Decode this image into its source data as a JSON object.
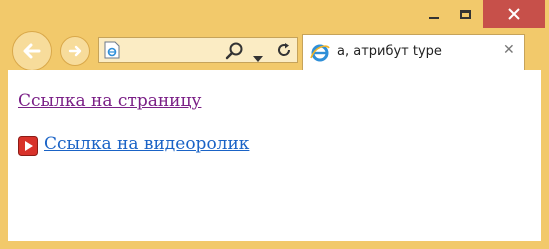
{
  "window": {
    "controls": {
      "minimize": "minimize",
      "maximize": "maximize",
      "close": "close"
    }
  },
  "toolbar": {
    "address_value": ""
  },
  "tab": {
    "title": "a, атрибут type",
    "close_glyph": "✕"
  },
  "content": {
    "link_page": "Ссылка на страницу",
    "link_video": "Ссылка на видеоролик"
  },
  "icons": {
    "back": "back-arrow-icon",
    "forward": "forward-arrow-icon",
    "page": "ie-page-icon",
    "search": "search-icon",
    "dropdown": "chevron-down-icon",
    "refresh": "refresh-icon",
    "tab": "ie-logo-icon",
    "video": "video-play-icon"
  },
  "colors": {
    "frame": "#f2c96b",
    "close_button": "#c7504a",
    "visited_link": "#7a1f86",
    "link": "#1a63c6"
  }
}
